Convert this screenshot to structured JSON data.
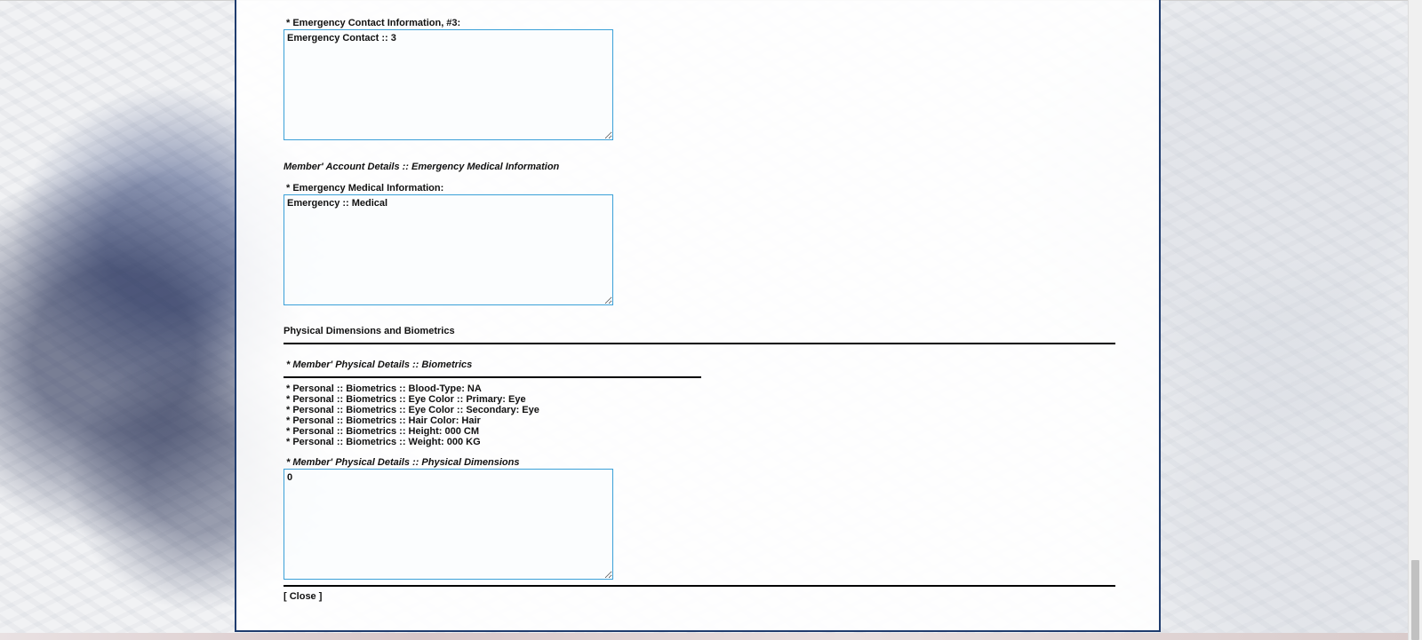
{
  "emergency_contact_3": {
    "label": "* Emergency Contact Information, #3:",
    "value": "Emergency Contact :: 3"
  },
  "medical_section": {
    "heading": "Member' Account Details :: Emergency Medical Information",
    "label": "* Emergency Medical Information:",
    "value": "Emergency :: Medical"
  },
  "physical_section": {
    "heading": "Physical Dimensions and Biometrics",
    "biometrics_heading": "* Member' Physical Details :: Biometrics",
    "biometrics": [
      "* Personal :: Biometrics :: Blood-Type: NA",
      "* Personal :: Biometrics :: Eye Color :: Primary: Eye",
      "* Personal :: Biometrics :: Eye Color :: Secondary: Eye",
      "* Personal :: Biometrics :: Hair Color: Hair",
      "* Personal :: Biometrics :: Height: 000 CM",
      "* Personal :: Biometrics :: Weight: 000 KG"
    ],
    "dimensions_label": "* Member' Physical Details :: Physical Dimensions",
    "dimensions_value": "0"
  },
  "footer": {
    "close_label": "[ Close ]"
  },
  "colors": {
    "panel_border": "#1f3c6e",
    "textbox_border": "#3aa0d8"
  }
}
